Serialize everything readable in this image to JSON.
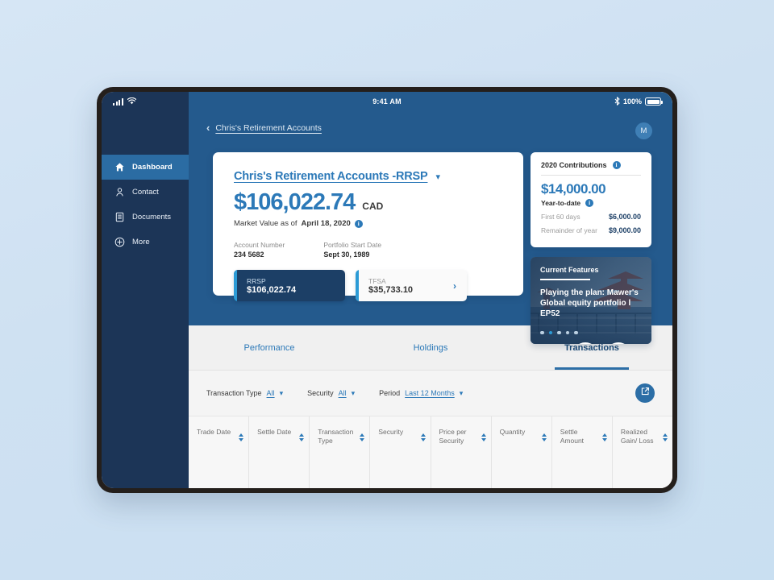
{
  "status_bar": {
    "time": "9:41 AM",
    "battery_percent": "100%",
    "signal_icon": "cellular-signal-icon",
    "wifi_icon": "wifi-icon",
    "bluetooth_icon": "bluetooth-icon",
    "battery_icon": "battery-icon"
  },
  "sidebar": {
    "items": [
      {
        "label": "Dashboard",
        "icon": "home-icon",
        "active": true
      },
      {
        "label": "Contact",
        "icon": "person-icon",
        "active": false
      },
      {
        "label": "Documents",
        "icon": "document-icon",
        "active": false
      },
      {
        "label": "More",
        "icon": "plus-circle-icon",
        "active": false
      }
    ]
  },
  "header": {
    "back_icon": "chevron-left-icon",
    "breadcrumb": "Chris's Retirement Accounts",
    "avatar_initial": "M"
  },
  "account_card": {
    "title": "Chris's Retirement Accounts -RRSP",
    "dropdown_icon": "chevron-down-icon",
    "balance": "$106,022.74",
    "currency": "CAD",
    "market_value_prefix": "Market Value as of",
    "market_value_date": "April 18, 2020",
    "info_icon": "info-icon",
    "meta": [
      {
        "label": "Account Number",
        "value": "234 5682"
      },
      {
        "label": "Portfolio Start Date",
        "value": "Sept 30, 1989"
      }
    ],
    "chips": [
      {
        "name": "RRSP",
        "value": "$106,022.74",
        "selected": true
      },
      {
        "name": "TFSA",
        "value": "$35,733.10",
        "selected": false
      }
    ],
    "prev_label": "‹",
    "next_label": "›"
  },
  "contributions": {
    "title": "2020 Contributions",
    "amount": "$14,000.00",
    "subtitle": "Year-to-date",
    "rows": [
      {
        "label": "First 60 days",
        "value": "$6,000.00"
      },
      {
        "label": "Remainder of year",
        "value": "$9,000.00"
      }
    ]
  },
  "features": {
    "title": "Current Features",
    "body": "Playing the plan: Mawer's Global equity portfolio l EP52",
    "dots": [
      false,
      true,
      false,
      false,
      false
    ],
    "prev_icon": "chevron-left-icon",
    "next_icon": "chevron-right-icon",
    "prev_label": "‹",
    "next_label": "›"
  },
  "tabs": [
    {
      "label": "Performance",
      "active": false
    },
    {
      "label": "Holdings",
      "active": false
    },
    {
      "label": "Transactions",
      "active": true
    }
  ],
  "filters": [
    {
      "label": "Transaction Type",
      "value": "All"
    },
    {
      "label": "Security",
      "value": "All"
    },
    {
      "label": "Period",
      "value": "Last 12 Months"
    }
  ],
  "export_icon": "external-link-icon",
  "table": {
    "columns": [
      "Trade Date",
      "Settle Date",
      "Transaction Type",
      "Security",
      "Price per Security",
      "Quantity",
      "Settle Amount",
      "Realized Gain/ Loss"
    ]
  },
  "colors": {
    "brand_navy": "#1c3557",
    "brand_blue": "#2c79b8",
    "header_blue": "#245a8d",
    "accent_cyan": "#2c9bd6",
    "page_bg": "#d6e6f5"
  }
}
